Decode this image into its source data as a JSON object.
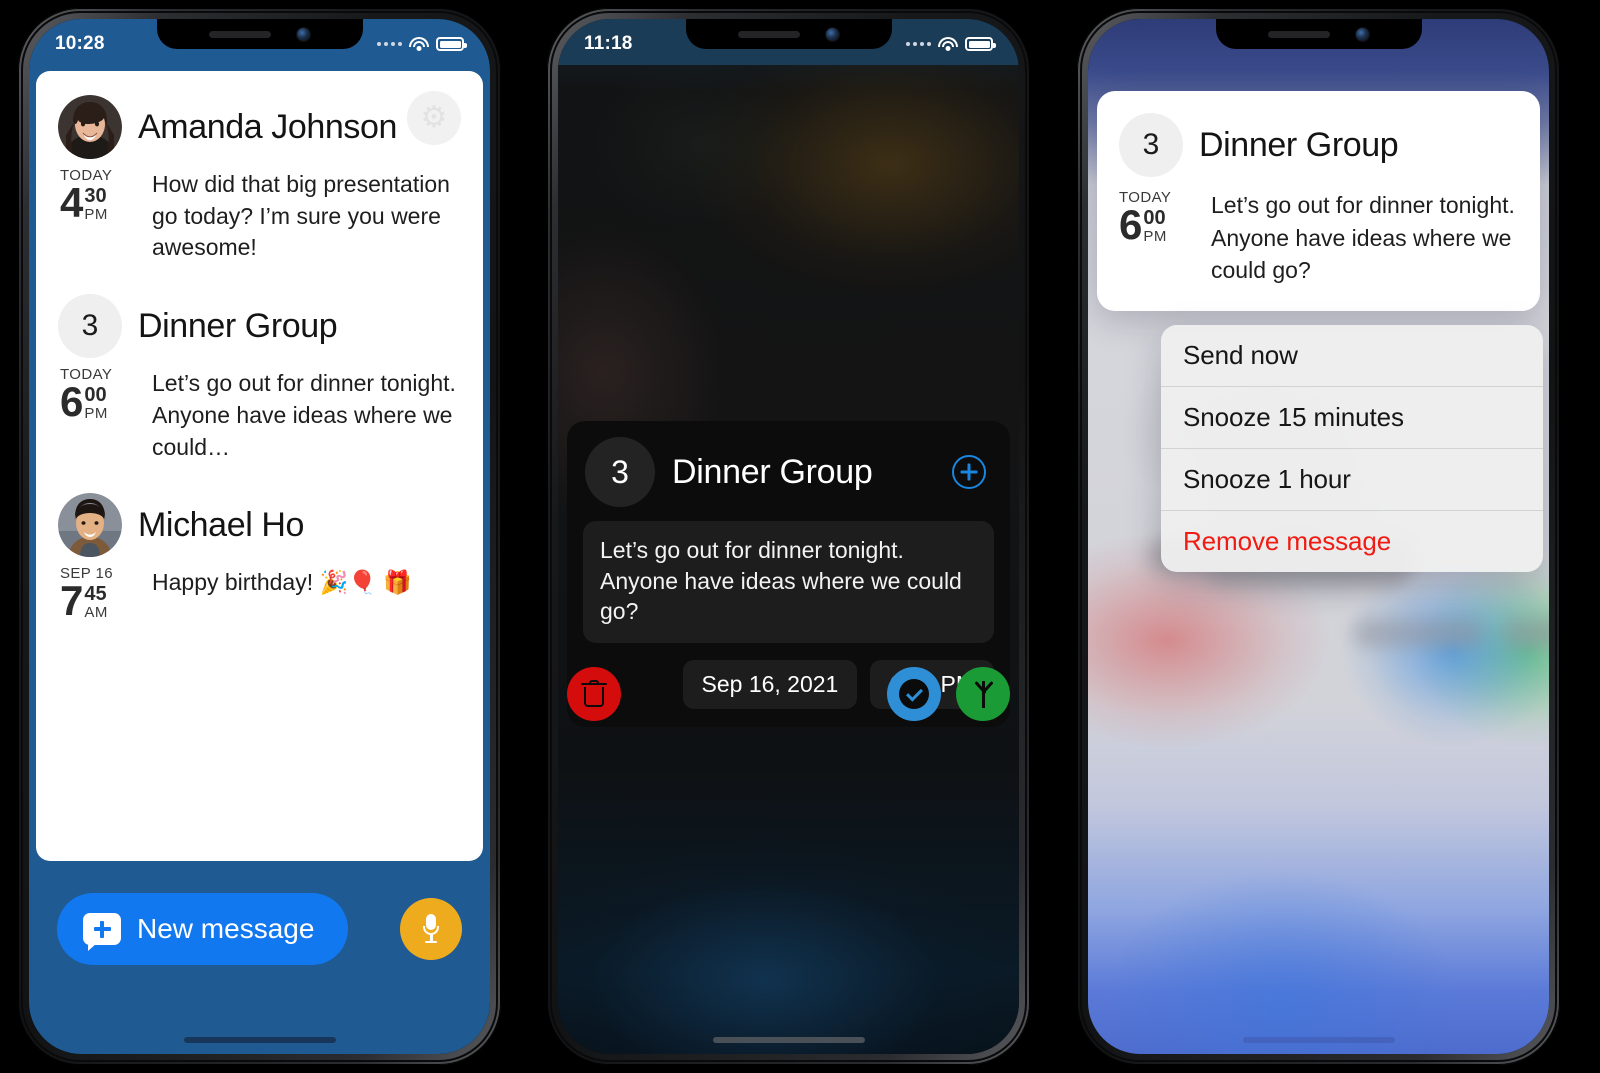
{
  "phones": [
    {
      "id": "messages-list",
      "status_bar": {
        "time": "10:28",
        "wifi_icon": "wifi-icon",
        "battery_icon": "battery-icon",
        "signal_icon": "signal-dots-icon"
      },
      "settings_button": {
        "icon": "gear-icon",
        "label": "Settings"
      },
      "threads": [
        {
          "name": "Amanda Johnson",
          "avatar_type": "photo",
          "avatar_name": "avatar-amanda-johnson",
          "day": "TODAY",
          "hour": "4",
          "minute": "30",
          "ampm": "PM",
          "message": "How did that big presentation go today? I’m sure you were awesome!"
        },
        {
          "name": "Dinner Group",
          "avatar_type": "count",
          "avatar_count": "3",
          "avatar_name": "avatar-dinner-group",
          "day": "TODAY",
          "hour": "6",
          "minute": "00",
          "ampm": "PM",
          "message": "Let’s go out for dinner tonight. Anyone have ideas where we could…"
        },
        {
          "name": "Michael Ho",
          "avatar_type": "photo",
          "avatar_name": "avatar-michael-ho",
          "day": "SEP 16",
          "hour": "7",
          "minute": "45",
          "ampm": "AM",
          "message": "Happy birthday! 🎉🎈 🎁"
        }
      ],
      "bottom_bar": {
        "new_message_label": "New message",
        "new_message_icon": "chat-bubble-plus-icon",
        "mic_icon": "microphone-icon"
      }
    },
    {
      "id": "message-detail",
      "status_bar": {
        "time": "11:18",
        "wifi_icon": "wifi-icon",
        "battery_icon": "battery-icon",
        "signal_icon": "signal-dots-icon"
      },
      "card": {
        "avatar_count": "3",
        "title": "Dinner Group",
        "add_icon": "plus-circle-icon",
        "message": "Let’s go out for dinner tonight. Anyone have ideas where we could go?",
        "date_chip": "Sep 16, 2021",
        "time_chip": "6:00 PM"
      },
      "actions": [
        {
          "name": "delete-button",
          "icon": "trash-icon",
          "color": "#d40c0c"
        },
        {
          "name": "confirm-button",
          "icon": "check-circle-icon",
          "color": "#2f8fd6"
        },
        {
          "name": "send-button",
          "icon": "arrow-up-icon",
          "color": "#1a9b36"
        }
      ]
    },
    {
      "id": "notification-actions",
      "notification": {
        "avatar_count": "3",
        "title": "Dinner Group",
        "day": "TODAY",
        "hour": "6",
        "minute": "00",
        "ampm": "PM",
        "message": "Let’s go out for dinner tonight. Anyone have ideas where we could go?"
      },
      "menu": [
        {
          "label": "Send now",
          "destructive": false
        },
        {
          "label": "Snooze 15 minutes",
          "destructive": false
        },
        {
          "label": "Snooze 1 hour",
          "destructive": false
        },
        {
          "label": "Remove message",
          "destructive": true
        }
      ]
    }
  ],
  "colors": {
    "phone1_header": "#205a92",
    "accent_blue": "#1278f0",
    "mic_yellow": "#efab1e",
    "delete_red": "#d40c0c",
    "confirm_blue": "#2f8fd6",
    "send_green": "#1a9b36",
    "destructive_red": "#f01b12"
  }
}
